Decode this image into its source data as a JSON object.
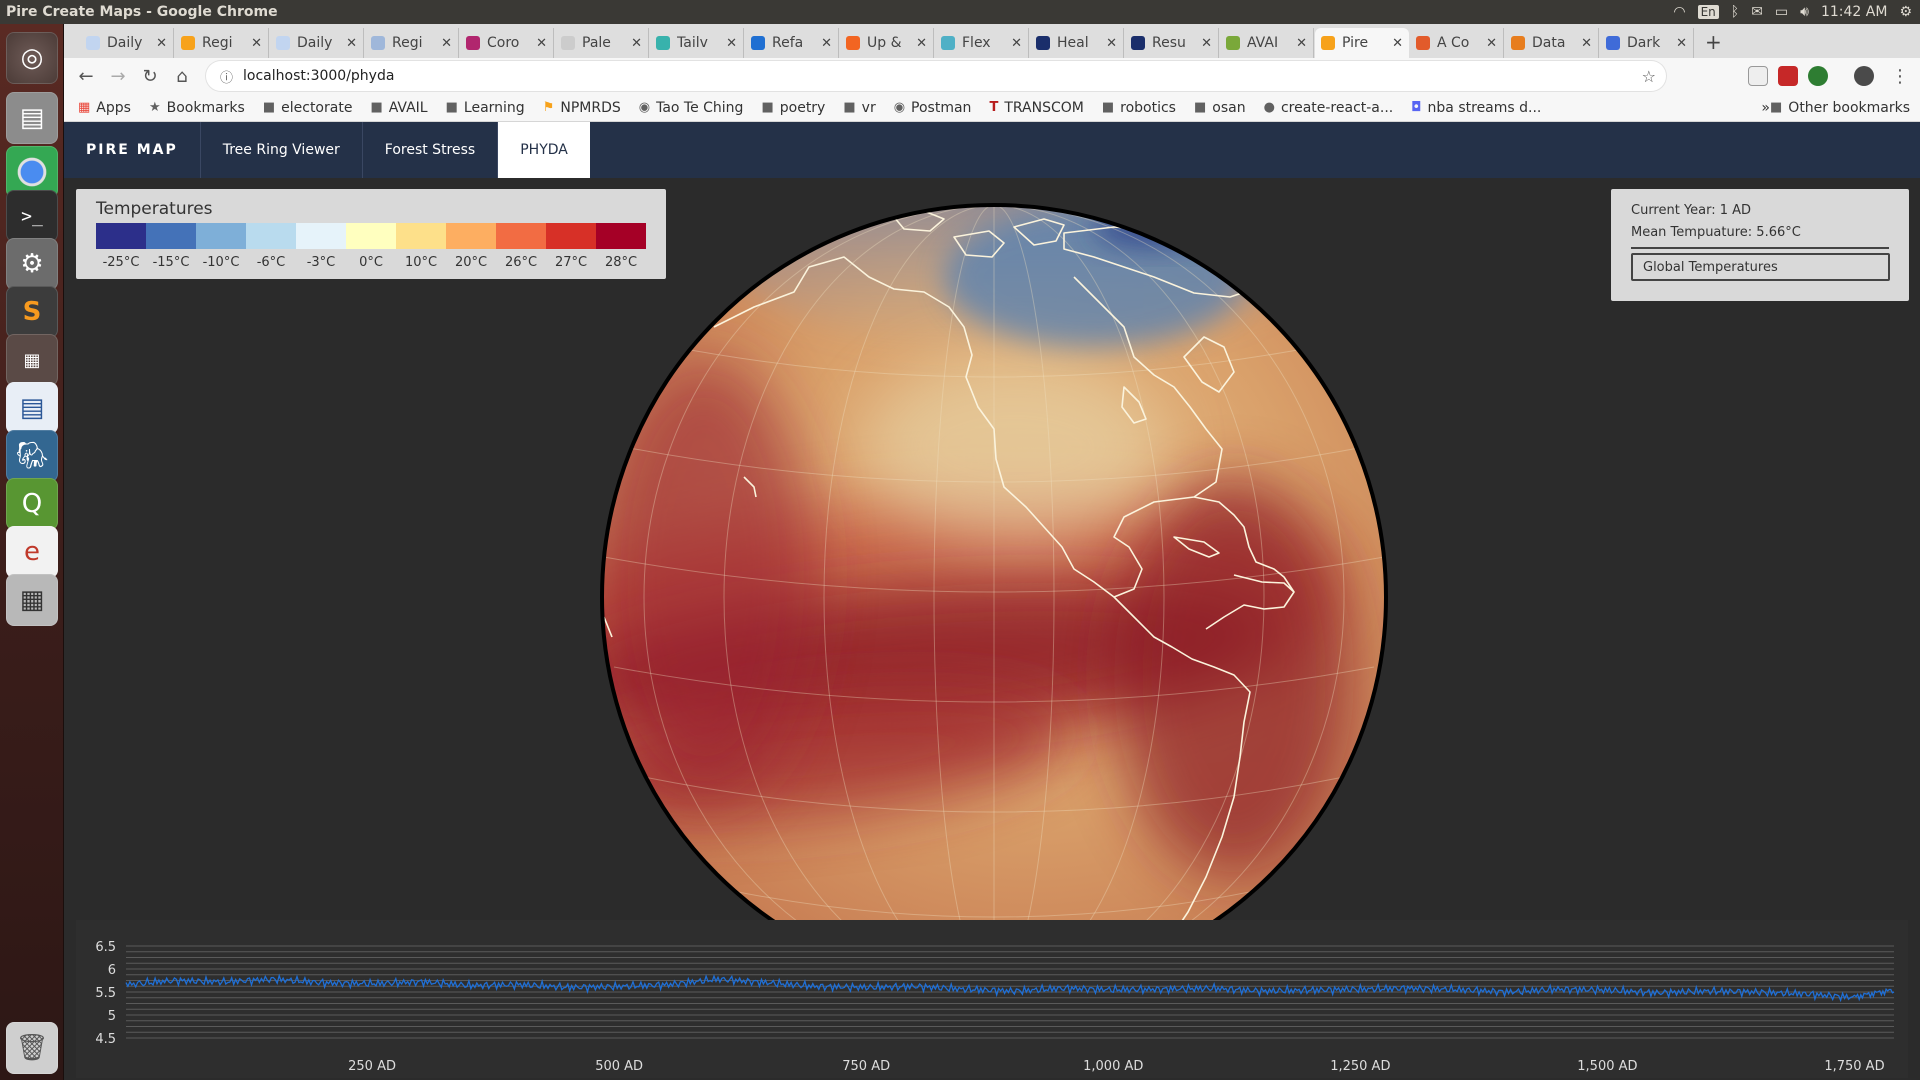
{
  "window": {
    "title": "Pire Create Maps - Google Chrome"
  },
  "system_tray": {
    "keyboard": "En",
    "clock": "11:42 AM"
  },
  "tabs": [
    {
      "label": "Daily",
      "color": "#c2d5f0"
    },
    {
      "label": "Regi",
      "color": "#f7a21b"
    },
    {
      "label": "Daily",
      "color": "#c2d5f0"
    },
    {
      "label": "Regi",
      "color": "#9fb7da"
    },
    {
      "label": "Coro",
      "color": "#b1266e"
    },
    {
      "label": "Pale",
      "color": "#cccccc"
    },
    {
      "label": "Tailv",
      "color": "#38b2ac"
    },
    {
      "label": "Refa",
      "color": "#1f6fd2"
    },
    {
      "label": "Up &",
      "color": "#f26522"
    },
    {
      "label": "Flex",
      "color": "#4fb0c6"
    },
    {
      "label": "Heal",
      "color": "#1a2e6b"
    },
    {
      "label": "Resu",
      "color": "#1a2e6b"
    },
    {
      "label": "AVAI",
      "color": "#7aa83a"
    },
    {
      "label": "Pire",
      "color": "#f7a21b",
      "active": true
    },
    {
      "label": "A Co",
      "color": "#e25b2b"
    },
    {
      "label": "Data",
      "color": "#e77d1e"
    },
    {
      "label": "Dark",
      "color": "#3f6bd8"
    }
  ],
  "address_bar": {
    "url": "localhost:3000/phyda"
  },
  "bookmarks": [
    {
      "label": "Apps",
      "icon": "apps-grid-icon"
    },
    {
      "label": "Bookmarks",
      "icon": "star-icon"
    },
    {
      "label": "electorate",
      "icon": "folder-icon"
    },
    {
      "label": "AVAIL",
      "icon": "folder-icon"
    },
    {
      "label": "Learning",
      "icon": "folder-icon"
    },
    {
      "label": "NPMRDS",
      "icon": "npmrds-icon"
    },
    {
      "label": "Tao Te Ching",
      "icon": "globe-icon"
    },
    {
      "label": "poetry",
      "icon": "folder-icon"
    },
    {
      "label": "vr",
      "icon": "folder-icon"
    },
    {
      "label": "Postman",
      "icon": "globe-icon"
    },
    {
      "label": "TRANSCOM",
      "icon": "transcom-icon"
    },
    {
      "label": "robotics",
      "icon": "folder-icon"
    },
    {
      "label": "osan",
      "icon": "folder-icon"
    },
    {
      "label": "create-react-a...",
      "icon": "github-icon"
    },
    {
      "label": "nba streams d...",
      "icon": "discord-icon"
    }
  ],
  "bookmarks_other": "Other bookmarks",
  "bookmarks_more": "»",
  "app_nav": {
    "brand": "PIRE MAP",
    "links": [
      {
        "label": "Tree Ring Viewer",
        "active": false
      },
      {
        "label": "Forest Stress",
        "active": false
      },
      {
        "label": "PHYDA",
        "active": true
      }
    ]
  },
  "legend": {
    "title": "Temperatures",
    "entries": [
      {
        "label": "-25°C",
        "color": "#2c2f8a"
      },
      {
        "label": "-15°C",
        "color": "#4472b8"
      },
      {
        "label": "-10°C",
        "color": "#7eafd8"
      },
      {
        "label": "-6°C",
        "color": "#b9dbee"
      },
      {
        "label": "-3°C",
        "color": "#e6f3fa"
      },
      {
        "label": "0°C",
        "color": "#ffffbf"
      },
      {
        "label": "10°C",
        "color": "#fde08a"
      },
      {
        "label": "20°C",
        "color": "#fdae61"
      },
      {
        "label": "26°C",
        "color": "#f26c43"
      },
      {
        "label": "27°C",
        "color": "#d73027"
      },
      {
        "label": "28°C",
        "color": "#a50026"
      }
    ]
  },
  "info": {
    "current_year": "Current Year: 1 AD",
    "mean_temperature": "Mean Tempuature: 5.66°C",
    "button_label": "Global Temperatures"
  },
  "chart_data": {
    "type": "line",
    "title": "",
    "xlabel": "",
    "ylabel": "",
    "xlim": [
      1,
      1790
    ],
    "ylim": [
      4.5,
      6.5
    ],
    "y_ticks": [
      6.5,
      6,
      5.5,
      5,
      4.5
    ],
    "y_tick_labels": [
      "6.5",
      "6",
      "5.5",
      "5",
      "4.5"
    ],
    "x_ticks": [
      250,
      500,
      750,
      1000,
      1250,
      1500,
      1750
    ],
    "x_tick_labels": [
      "250 AD",
      "500 AD",
      "750 AD",
      "1,000 AD",
      "1,250 AD",
      "1,500 AD",
      "1,750 AD"
    ],
    "grid": true,
    "series": [
      {
        "color": "#1f6fd6",
        "x": [
          1,
          50,
          100,
          150,
          200,
          250,
          300,
          350,
          400,
          450,
          500,
          550,
          600,
          650,
          700,
          750,
          800,
          850,
          900,
          950,
          1000,
          1050,
          1100,
          1150,
          1200,
          1250,
          1300,
          1350,
          1400,
          1450,
          1500,
          1550,
          1600,
          1650,
          1700,
          1750,
          1790
        ],
        "values": [
          5.66,
          5.75,
          5.72,
          5.78,
          5.7,
          5.68,
          5.72,
          5.64,
          5.66,
          5.6,
          5.62,
          5.66,
          5.78,
          5.7,
          5.62,
          5.6,
          5.62,
          5.56,
          5.52,
          5.58,
          5.55,
          5.56,
          5.58,
          5.52,
          5.54,
          5.56,
          5.58,
          5.55,
          5.5,
          5.56,
          5.54,
          5.48,
          5.52,
          5.5,
          5.46,
          5.38,
          5.5
        ]
      }
    ]
  }
}
